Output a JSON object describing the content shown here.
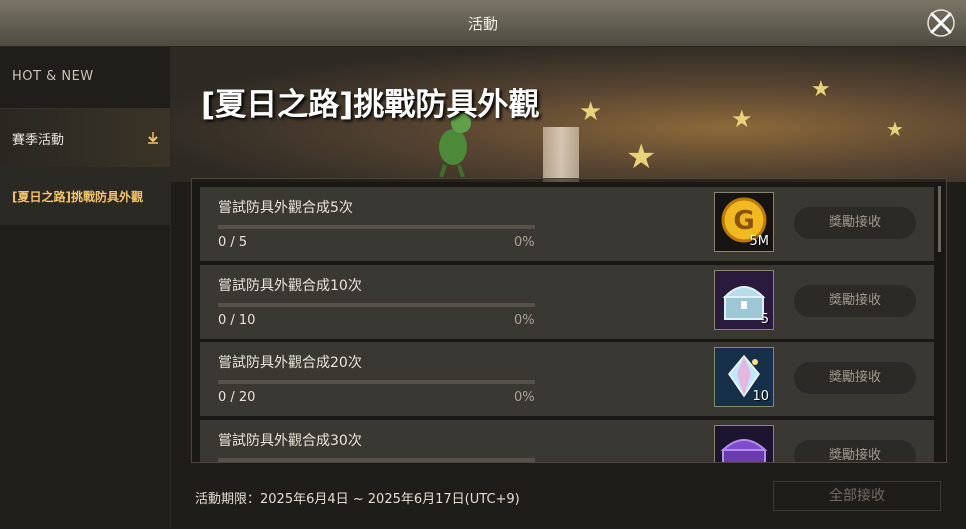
{
  "window": {
    "title": "活動"
  },
  "sidebar": {
    "hot_new": "HOT & NEW",
    "season_label": "賽季活動",
    "event_label": "[夏日之路]挑戰防具外觀"
  },
  "banner": {
    "heading": "[夏日之路]挑戰防具外觀"
  },
  "missions": [
    {
      "task": "嘗試防具外觀合成5次",
      "count": "0 / 5",
      "percent": "0%",
      "progress": 0,
      "reward_icon": "gold-coin-icon",
      "reward_qty": "5M",
      "claim_label": "獎勵接收"
    },
    {
      "task": "嘗試防具外觀合成10次",
      "count": "0 / 10",
      "percent": "0%",
      "progress": 0,
      "reward_icon": "silver-chest-icon",
      "reward_qty": "5",
      "claim_label": "獎勵接收"
    },
    {
      "task": "嘗試防具外觀合成20次",
      "count": "0 / 20",
      "percent": "0%",
      "progress": 0,
      "reward_icon": "crystal-gem-icon",
      "reward_qty": "10",
      "claim_label": "獎勵接收"
    },
    {
      "task": "嘗試防具外觀合成30次",
      "count": "",
      "percent": "",
      "progress": 0,
      "reward_icon": "purple-chest-icon",
      "reward_qty": "",
      "claim_label": "獎勵接收"
    }
  ],
  "footer": {
    "period": "活動期限：2025年6月4日 ~ 2025年6月17日(UTC+9)",
    "claim_all": "全部接收"
  },
  "colors": {
    "accent_gold": "#f2c36b",
    "panel_bg": "#3a3833",
    "disabled_text": "#6f6b62"
  }
}
